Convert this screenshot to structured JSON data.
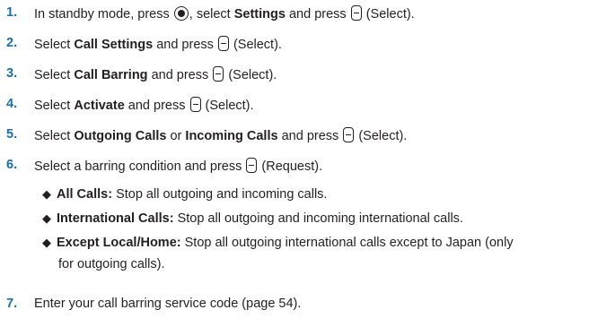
{
  "steps": [
    {
      "num": "1.",
      "t1": "In standby mode, press",
      "t2": ", select",
      "b1": "Settings",
      "t3": "and press",
      "t4": "(Select)."
    },
    {
      "num": "2.",
      "t1": "Select",
      "b1": "Call Settings",
      "t2": "and press",
      "t3": "(Select)."
    },
    {
      "num": "3.",
      "t1": "Select",
      "b1": "Call Barring",
      "t2": "and press",
      "t3": "(Select)."
    },
    {
      "num": "4.",
      "t1": "Select",
      "b1": "Activate",
      "t2": "and press",
      "t3": "(Select)."
    },
    {
      "num": "5.",
      "t1": "Select",
      "b1": "Outgoing Calls",
      "t2": "or",
      "b2": "Incoming Calls",
      "t3": "and press",
      "t4": "(Select)."
    },
    {
      "num": "6.",
      "t1": "Select a barring condition and press",
      "t2": "(Request)."
    },
    {
      "num": "7.",
      "t1": "Enter your call barring service code (page 54)."
    }
  ],
  "conditions": [
    {
      "bullet": "◆",
      "label": "All Calls:",
      "text": "Stop all outgoing and incoming calls."
    },
    {
      "bullet": "◆",
      "label": "International Calls:",
      "text": "Stop all outgoing and incoming international calls."
    },
    {
      "bullet": "◆",
      "label": "Except Local/Home:",
      "text": "Stop all outgoing international calls except to Japan (only",
      "cont": "for outgoing calls)."
    }
  ]
}
